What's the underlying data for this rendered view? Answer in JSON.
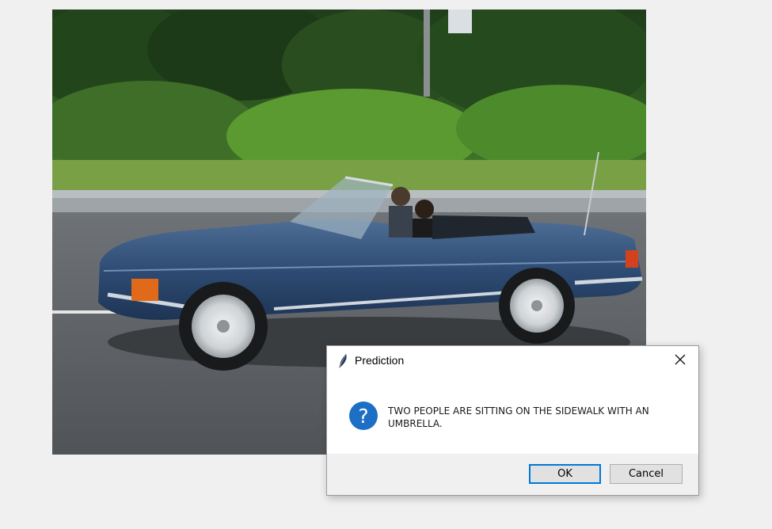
{
  "photo": {
    "description_icon": "car-photo"
  },
  "dialog": {
    "title": "Prediction",
    "title_icon": "feather-icon",
    "close_icon": "close-icon",
    "message_icon": "question-icon",
    "message": "TWO PEOPLE ARE SITTING ON THE SIDEWALK WITH AN UMBRELLA.",
    "ok_label": "OK",
    "cancel_label": "Cancel",
    "accent_color": "#0078d7",
    "icon_color": "#1d6fc5"
  }
}
